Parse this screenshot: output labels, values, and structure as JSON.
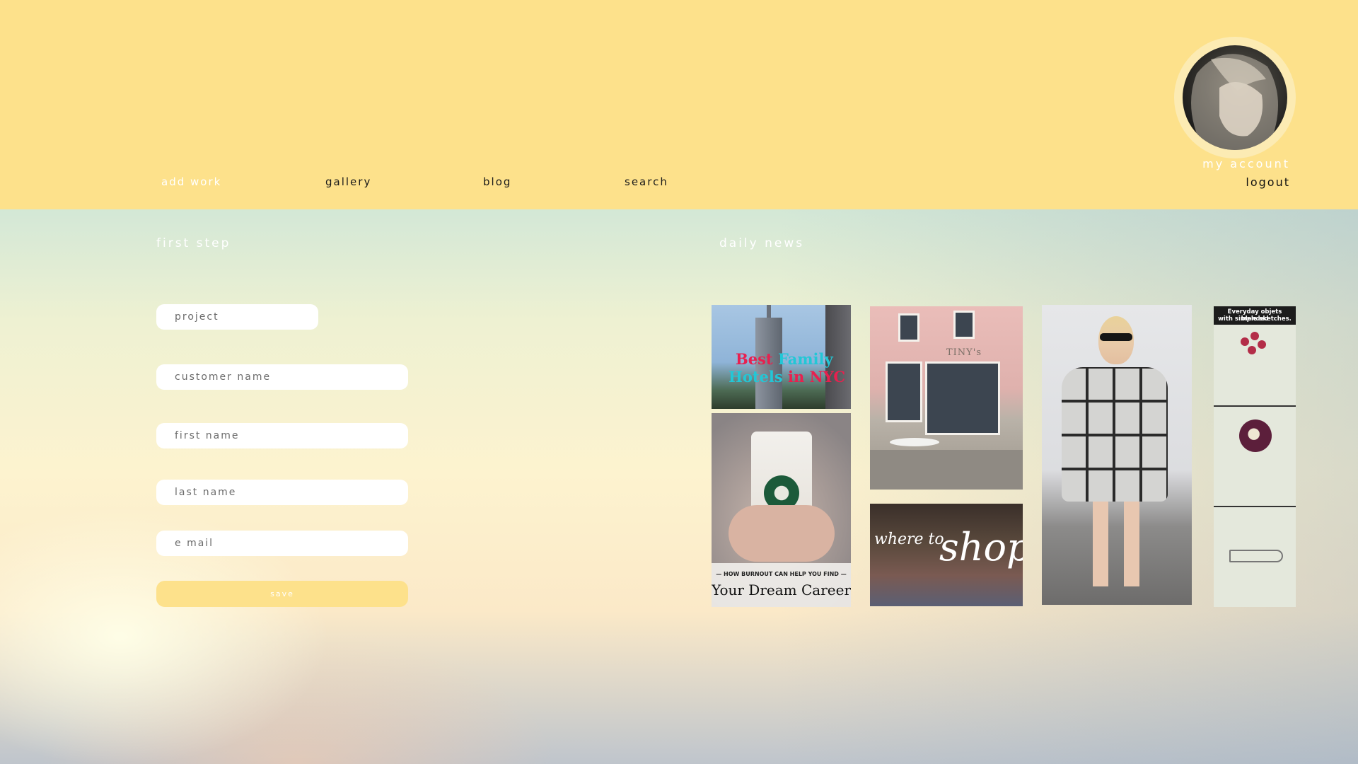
{
  "nav": {
    "items": [
      {
        "label": "add work"
      },
      {
        "label": "gallery"
      },
      {
        "label": "blog"
      },
      {
        "label": "search"
      }
    ]
  },
  "account": {
    "my_account_label": "my account",
    "logout_label": "logout"
  },
  "form": {
    "title": "first step",
    "fields": [
      {
        "placeholder": "project"
      },
      {
        "placeholder": "customer name"
      },
      {
        "placeholder": "first name"
      },
      {
        "placeholder": "last name"
      },
      {
        "placeholder": "e mail"
      }
    ],
    "save_label": "save"
  },
  "news": {
    "title": "daily news",
    "tiles": {
      "nyc": {
        "line1a": "Best",
        "line1b": "Family",
        "line2a": "Hotels",
        "line2b": "in NYC"
      },
      "coffee": {
        "kicker": "— HOW BURNOUT CAN HELP YOU FIND —",
        "headline": "Your Dream Career"
      },
      "cafe": {
        "sign": "TINY's"
      },
      "shop": {
        "pre": "where to",
        "main": "shop"
      },
      "sketch": {
        "caption_line1": "Everyday objets blended",
        "caption_line2": "with simple sketches."
      }
    }
  },
  "colors": {
    "header_bg": "#fde18b",
    "accent_pink": "#e8204f",
    "accent_cyan": "#22c7d6",
    "save_button": "#fde18b"
  }
}
